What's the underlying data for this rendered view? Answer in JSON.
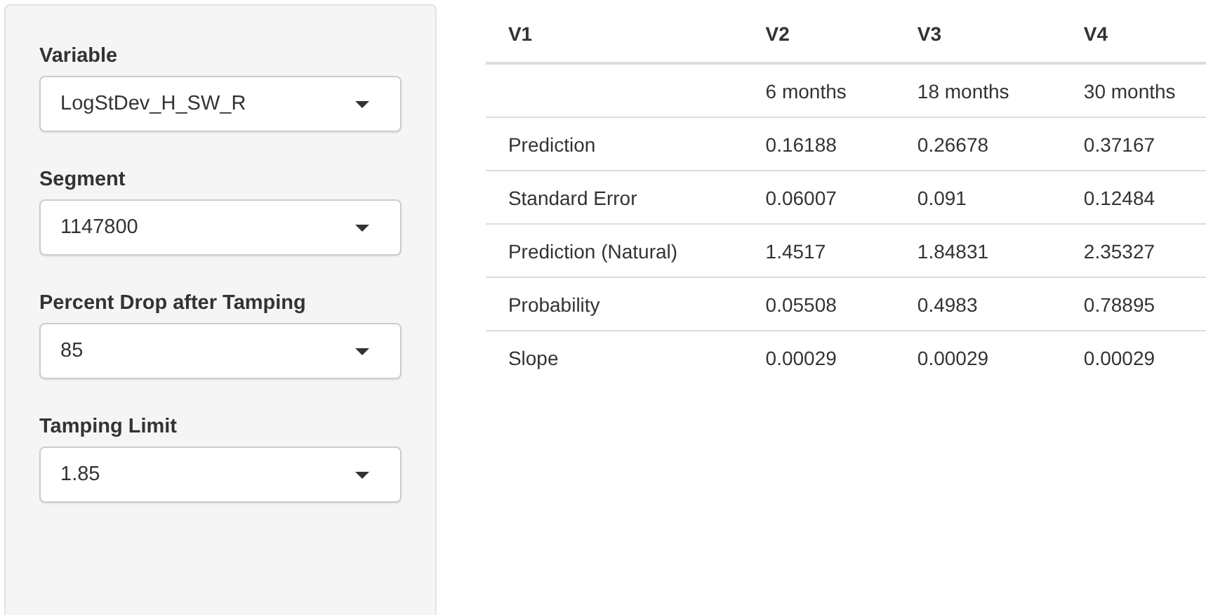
{
  "sidebar": {
    "fields": [
      {
        "label": "Variable",
        "value": "LogStDev_H_SW_R"
      },
      {
        "label": "Segment",
        "value": "1147800"
      },
      {
        "label": "Percent Drop after Tamping",
        "value": "85"
      },
      {
        "label": "Tamping Limit",
        "value": "1.85"
      }
    ]
  },
  "table": {
    "columns": [
      "V1",
      "V2",
      "V3",
      "V4"
    ],
    "rows": [
      [
        null,
        "6 months",
        "18 months",
        "30 months"
      ],
      [
        "Prediction",
        "0.16188",
        "0.26678",
        "0.37167"
      ],
      [
        "Standard Error",
        "0.06007",
        "0.091",
        "0.12484"
      ],
      [
        "Prediction (Natural)",
        "1.4517",
        "1.84831",
        "2.35327"
      ],
      [
        "Probability",
        "0.05508",
        "0.4983",
        "0.78895"
      ],
      [
        "Slope",
        "0.00029",
        "0.00029",
        "0.00029"
      ]
    ]
  }
}
